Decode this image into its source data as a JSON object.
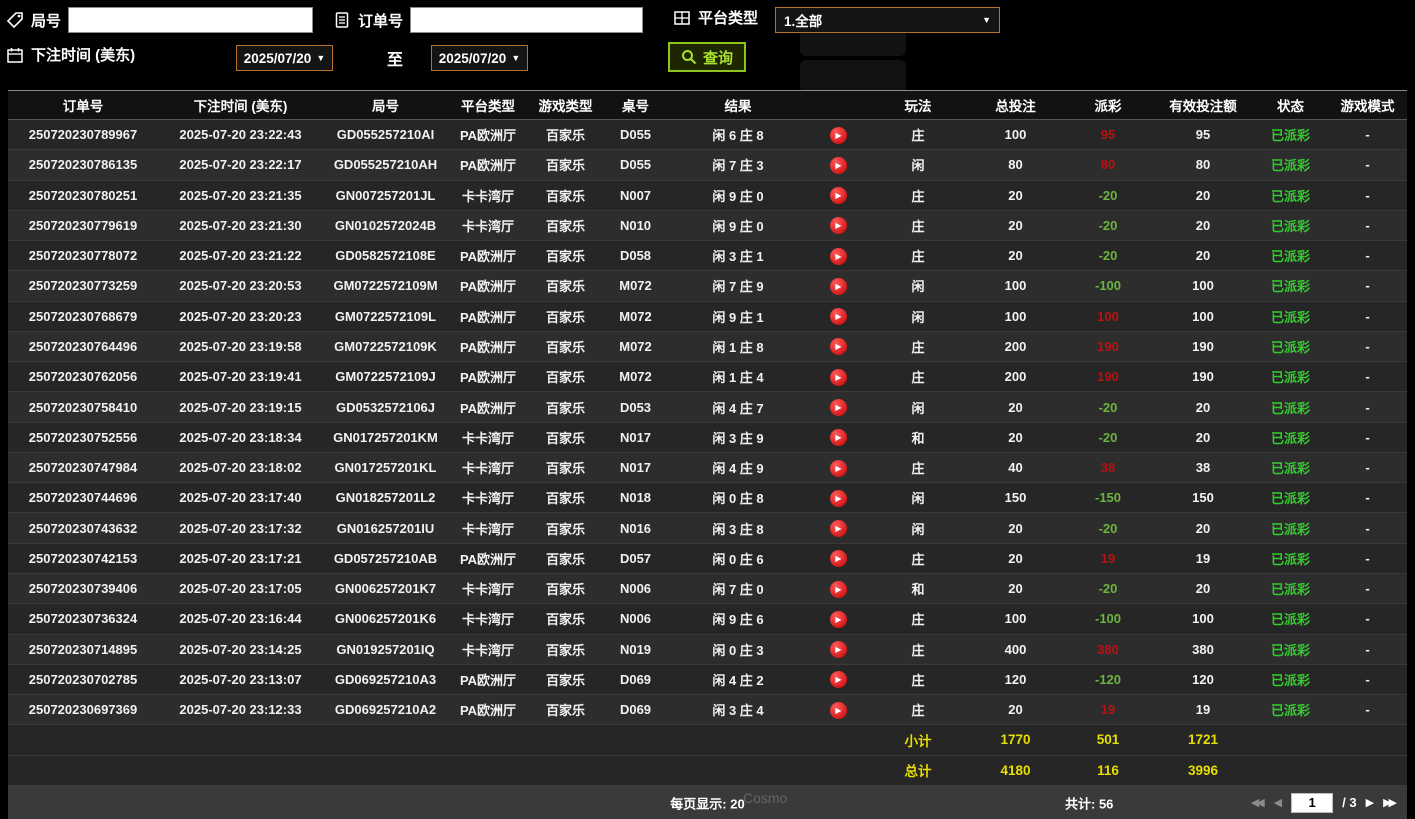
{
  "icons": {
    "chevron_down": "▼",
    "play": "▶",
    "first_page": "◀◀",
    "prev_page": "◀",
    "next_page": "▶",
    "last_page": "▶▶"
  },
  "filters": {
    "round_label": "局号",
    "round_value": "",
    "order_label": "订单号",
    "order_value": "",
    "platform_label": "平台类型",
    "platform_value": "1.全部",
    "bet_time_label": "下注时间 (美东)",
    "date_from": "2025/07/20",
    "to_label": "至",
    "date_to": "2025/07/20",
    "search_label": "查询"
  },
  "table": {
    "headers": [
      "订单号",
      "下注时间 (美东)",
      "局号",
      "平台类型",
      "游戏类型",
      "桌号",
      "结果",
      "",
      "玩法",
      "总投注",
      "派彩",
      "有效投注额",
      "状态",
      "游戏模式"
    ],
    "rows": [
      {
        "order": "250720230789967",
        "time": "2025-07-20 23:22:43",
        "round": "GD055257210AI",
        "platform": "PA欧洲厅",
        "game": "百家乐",
        "table_no": "D055",
        "result": "闲 6 庄 8",
        "play": "庄",
        "total_bet": "100",
        "payout": "95",
        "valid_bet": "95",
        "status": "已派彩",
        "mode": "-"
      },
      {
        "order": "250720230786135",
        "time": "2025-07-20 23:22:17",
        "round": "GD055257210AH",
        "platform": "PA欧洲厅",
        "game": "百家乐",
        "table_no": "D055",
        "result": "闲 7 庄 3",
        "play": "闲",
        "total_bet": "80",
        "payout": "80",
        "valid_bet": "80",
        "status": "已派彩",
        "mode": "-"
      },
      {
        "order": "250720230780251",
        "time": "2025-07-20 23:21:35",
        "round": "GN007257201JL",
        "platform": "卡卡湾厅",
        "game": "百家乐",
        "table_no": "N007",
        "result": "闲 9 庄 0",
        "play": "庄",
        "total_bet": "20",
        "payout": "-20",
        "valid_bet": "20",
        "status": "已派彩",
        "mode": "-"
      },
      {
        "order": "250720230779619",
        "time": "2025-07-20 23:21:30",
        "round": "GN0102572024B",
        "platform": "卡卡湾厅",
        "game": "百家乐",
        "table_no": "N010",
        "result": "闲 9 庄 0",
        "play": "庄",
        "total_bet": "20",
        "payout": "-20",
        "valid_bet": "20",
        "status": "已派彩",
        "mode": "-"
      },
      {
        "order": "250720230778072",
        "time": "2025-07-20 23:21:22",
        "round": "GD0582572108E",
        "platform": "PA欧洲厅",
        "game": "百家乐",
        "table_no": "D058",
        "result": "闲 3 庄 1",
        "play": "庄",
        "total_bet": "20",
        "payout": "-20",
        "valid_bet": "20",
        "status": "已派彩",
        "mode": "-"
      },
      {
        "order": "250720230773259",
        "time": "2025-07-20 23:20:53",
        "round": "GM0722572109M",
        "platform": "PA欧洲厅",
        "game": "百家乐",
        "table_no": "M072",
        "result": "闲 7 庄 9",
        "play": "闲",
        "total_bet": "100",
        "payout": "-100",
        "valid_bet": "100",
        "status": "已派彩",
        "mode": "-"
      },
      {
        "order": "250720230768679",
        "time": "2025-07-20 23:20:23",
        "round": "GM0722572109L",
        "platform": "PA欧洲厅",
        "game": "百家乐",
        "table_no": "M072",
        "result": "闲 9 庄 1",
        "play": "闲",
        "total_bet": "100",
        "payout": "100",
        "valid_bet": "100",
        "status": "已派彩",
        "mode": "-"
      },
      {
        "order": "250720230764496",
        "time": "2025-07-20 23:19:58",
        "round": "GM0722572109K",
        "platform": "PA欧洲厅",
        "game": "百家乐",
        "table_no": "M072",
        "result": "闲 1 庄 8",
        "play": "庄",
        "total_bet": "200",
        "payout": "190",
        "valid_bet": "190",
        "status": "已派彩",
        "mode": "-"
      },
      {
        "order": "250720230762056",
        "time": "2025-07-20 23:19:41",
        "round": "GM0722572109J",
        "platform": "PA欧洲厅",
        "game": "百家乐",
        "table_no": "M072",
        "result": "闲 1 庄 4",
        "play": "庄",
        "total_bet": "200",
        "payout": "190",
        "valid_bet": "190",
        "status": "已派彩",
        "mode": "-"
      },
      {
        "order": "250720230758410",
        "time": "2025-07-20 23:19:15",
        "round": "GD0532572106J",
        "platform": "PA欧洲厅",
        "game": "百家乐",
        "table_no": "D053",
        "result": "闲 4 庄 7",
        "play": "闲",
        "total_bet": "20",
        "payout": "-20",
        "valid_bet": "20",
        "status": "已派彩",
        "mode": "-"
      },
      {
        "order": "250720230752556",
        "time": "2025-07-20 23:18:34",
        "round": "GN017257201KM",
        "platform": "卡卡湾厅",
        "game": "百家乐",
        "table_no": "N017",
        "result": "闲 3 庄 9",
        "play": "和",
        "total_bet": "20",
        "payout": "-20",
        "valid_bet": "20",
        "status": "已派彩",
        "mode": "-"
      },
      {
        "order": "250720230747984",
        "time": "2025-07-20 23:18:02",
        "round": "GN017257201KL",
        "platform": "卡卡湾厅",
        "game": "百家乐",
        "table_no": "N017",
        "result": "闲 4 庄 9",
        "play": "庄",
        "total_bet": "40",
        "payout": "38",
        "valid_bet": "38",
        "status": "已派彩",
        "mode": "-"
      },
      {
        "order": "250720230744696",
        "time": "2025-07-20 23:17:40",
        "round": "GN018257201L2",
        "platform": "卡卡湾厅",
        "game": "百家乐",
        "table_no": "N018",
        "result": "闲 0 庄 8",
        "play": "闲",
        "total_bet": "150",
        "payout": "-150",
        "valid_bet": "150",
        "status": "已派彩",
        "mode": "-"
      },
      {
        "order": "250720230743632",
        "time": "2025-07-20 23:17:32",
        "round": "GN016257201IU",
        "platform": "卡卡湾厅",
        "game": "百家乐",
        "table_no": "N016",
        "result": "闲 3 庄 8",
        "play": "闲",
        "total_bet": "20",
        "payout": "-20",
        "valid_bet": "20",
        "status": "已派彩",
        "mode": "-"
      },
      {
        "order": "250720230742153",
        "time": "2025-07-20 23:17:21",
        "round": "GD057257210AB",
        "platform": "PA欧洲厅",
        "game": "百家乐",
        "table_no": "D057",
        "result": "闲 0 庄 6",
        "play": "庄",
        "total_bet": "20",
        "payout": "19",
        "valid_bet": "19",
        "status": "已派彩",
        "mode": "-"
      },
      {
        "order": "250720230739406",
        "time": "2025-07-20 23:17:05",
        "round": "GN006257201K7",
        "platform": "卡卡湾厅",
        "game": "百家乐",
        "table_no": "N006",
        "result": "闲 7 庄 0",
        "play": "和",
        "total_bet": "20",
        "payout": "-20",
        "valid_bet": "20",
        "status": "已派彩",
        "mode": "-"
      },
      {
        "order": "250720230736324",
        "time": "2025-07-20 23:16:44",
        "round": "GN006257201K6",
        "platform": "卡卡湾厅",
        "game": "百家乐",
        "table_no": "N006",
        "result": "闲 9 庄 6",
        "play": "庄",
        "total_bet": "100",
        "payout": "-100",
        "valid_bet": "100",
        "status": "已派彩",
        "mode": "-"
      },
      {
        "order": "250720230714895",
        "time": "2025-07-20 23:14:25",
        "round": "GN019257201IQ",
        "platform": "卡卡湾厅",
        "game": "百家乐",
        "table_no": "N019",
        "result": "闲 0 庄 3",
        "play": "庄",
        "total_bet": "400",
        "payout": "380",
        "valid_bet": "380",
        "status": "已派彩",
        "mode": "-"
      },
      {
        "order": "250720230702785",
        "time": "2025-07-20 23:13:07",
        "round": "GD069257210A3",
        "platform": "PA欧洲厅",
        "game": "百家乐",
        "table_no": "D069",
        "result": "闲 4 庄 2",
        "play": "庄",
        "total_bet": "120",
        "payout": "-120",
        "valid_bet": "120",
        "status": "已派彩",
        "mode": "-"
      },
      {
        "order": "250720230697369",
        "time": "2025-07-20 23:12:33",
        "round": "GD069257210A2",
        "platform": "PA欧洲厅",
        "game": "百家乐",
        "table_no": "D069",
        "result": "闲 3 庄 4",
        "play": "庄",
        "total_bet": "20",
        "payout": "19",
        "valid_bet": "19",
        "status": "已派彩",
        "mode": "-"
      }
    ],
    "subtotal": {
      "label": "小计",
      "total_bet": "1770",
      "payout": "501",
      "valid_bet": "1721"
    },
    "grand_total": {
      "label": "总计",
      "total_bet": "4180",
      "payout": "116",
      "valid_bet": "3996"
    }
  },
  "footer": {
    "per_page": "每页显示: 20",
    "total_count": "共计: 56",
    "page": "1",
    "page_total": "/ 3"
  },
  "colors": {
    "payout_positive": "#b81212",
    "payout_negative": "#6cb33f",
    "status_paid": "#35cb2f",
    "summary_yellow": "#e6df00",
    "select_border_orange": "#b5722a",
    "search_green": "#8fc31f",
    "play_icon_red": "#c40000"
  },
  "watermark": {
    "bottom_text": "Cosmo"
  }
}
